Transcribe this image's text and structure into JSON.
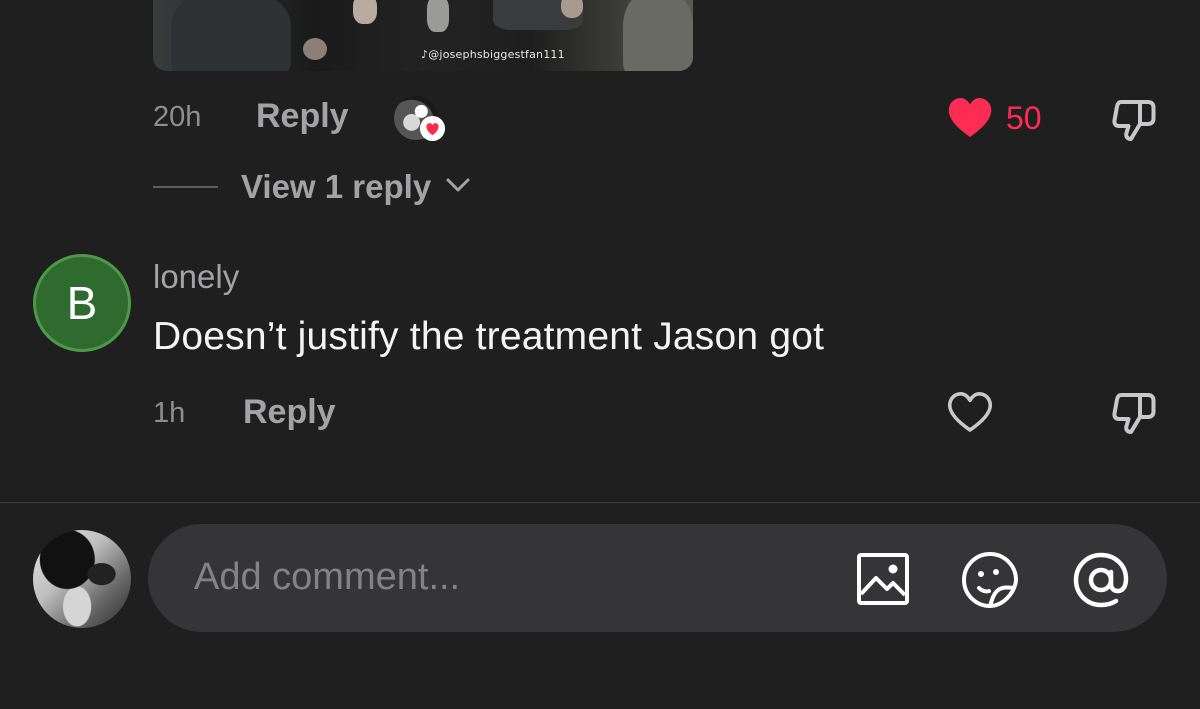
{
  "photo": {
    "watermark": "@josephsbiggestfan111"
  },
  "first_comment_actions": {
    "time": "20h",
    "reply_label": "Reply",
    "like_count": "50",
    "liked": true,
    "view_replies_label": "View 1 reply"
  },
  "comment": {
    "avatar_letter": "B",
    "username": "lonely",
    "text": "Doesn’t justify the treatment Jason got",
    "time": "1h",
    "reply_label": "Reply",
    "liked": false
  },
  "composer": {
    "placeholder": "Add comment..."
  },
  "colors": {
    "background": "#1f1f20",
    "like_red": "#fe2c55",
    "avatar_green": "#2f6b2e",
    "muted_text": "#a3a3a5"
  },
  "icons": [
    "heart-filled-icon",
    "heart-outline-icon",
    "thumbs-down-icon",
    "chevron-down-icon",
    "image-icon",
    "sticker-icon",
    "mention-icon",
    "tiktok-logo-icon"
  ]
}
